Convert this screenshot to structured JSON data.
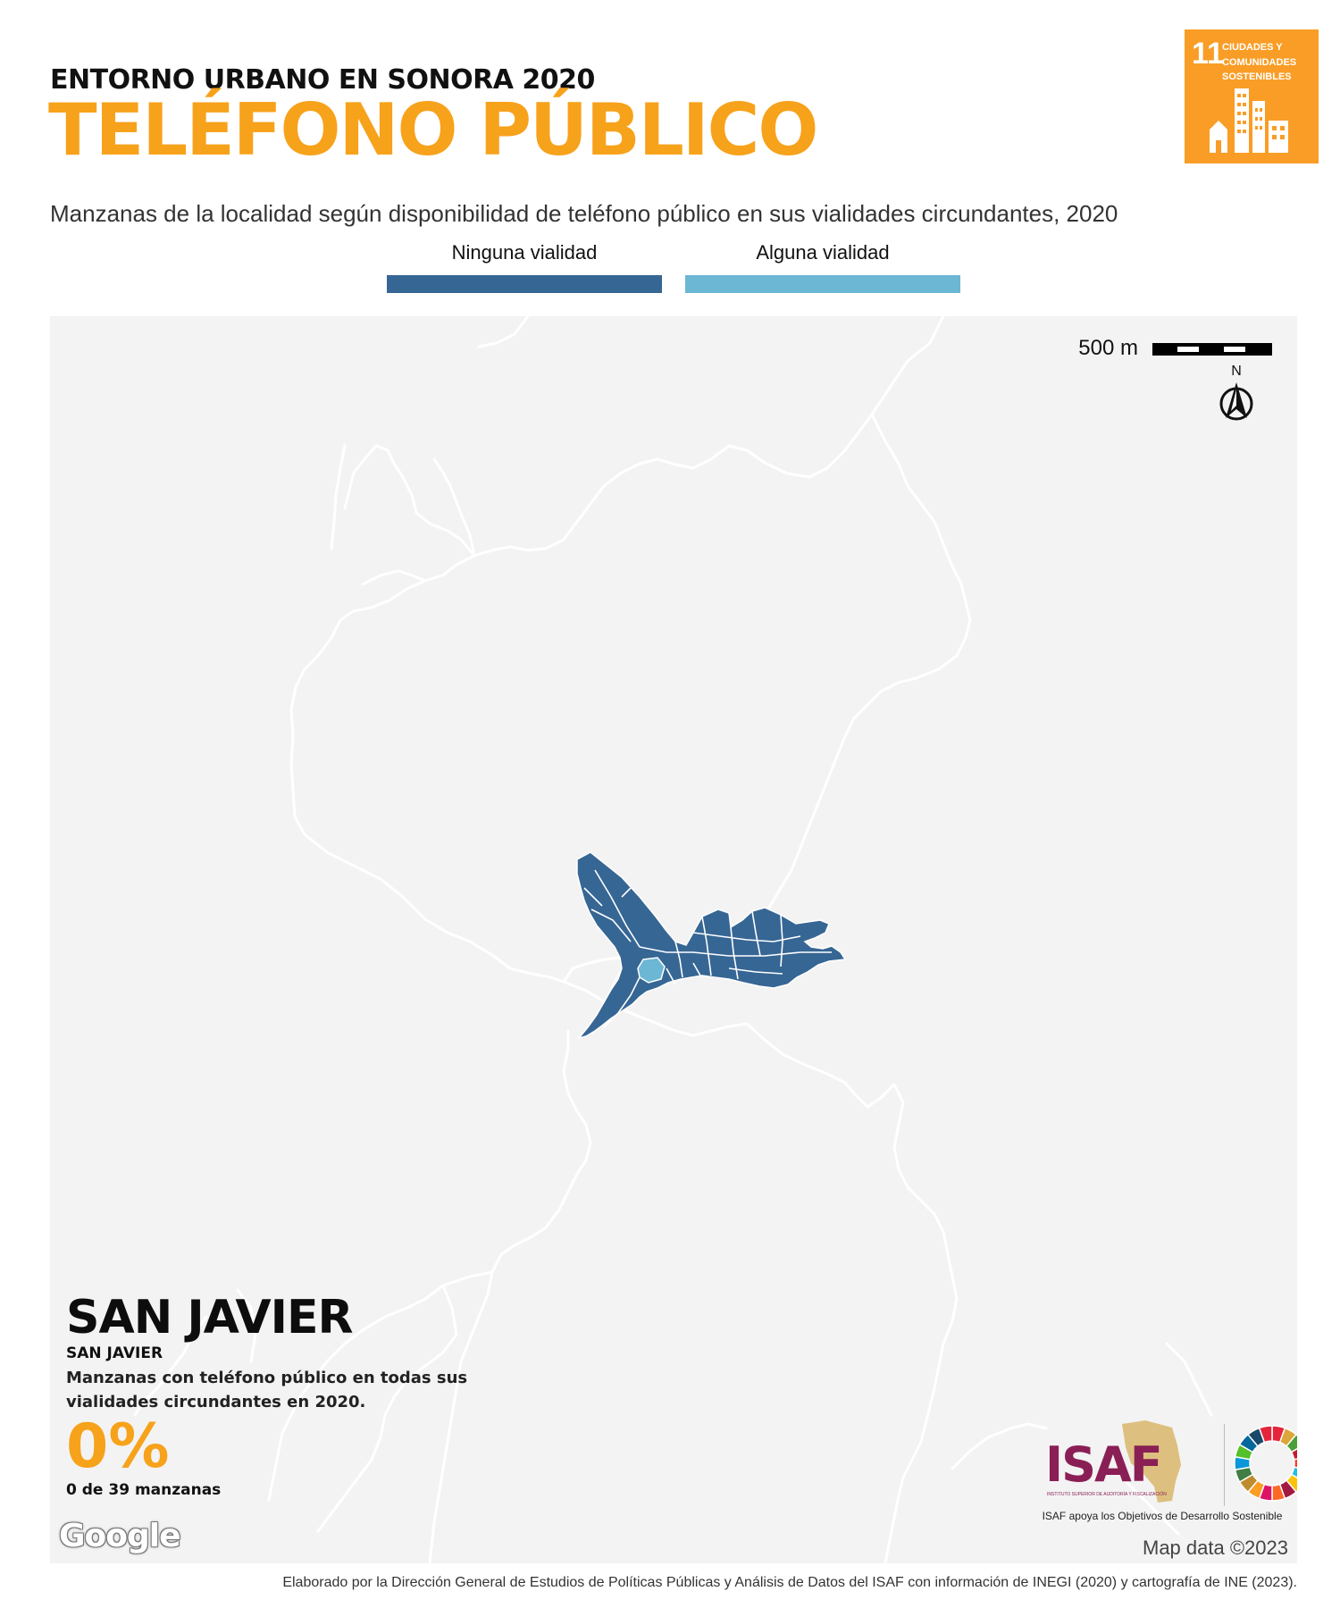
{
  "header": {
    "kicker": "ENTORNO URBANO EN SONORA 2020",
    "title": "TELÉFONO PÚBLICO",
    "subtitle": "Manzanas de la localidad según disponibilidad de teléfono público en sus vialidades circundantes, 2020"
  },
  "sdg_badge": {
    "number": "11",
    "text": "CIUDADES Y COMUNIDADES SOSTENIBLES",
    "color": "#f99d26"
  },
  "legend": {
    "items": [
      {
        "label": "Ninguna vialidad",
        "color": "#366694"
      },
      {
        "label": "Alguna vialidad",
        "color": "#6cb7d4"
      }
    ]
  },
  "map": {
    "scale_label": "500 m",
    "north_label": "N",
    "attribution_logo": "Google",
    "attribution": "Map data ©2023",
    "colors": {
      "background": "#f3f3f3",
      "roads": "#ffffff",
      "blocks_none": "#366694",
      "blocks_some": "#6cb7d4"
    }
  },
  "info": {
    "place": "SAN JAVIER",
    "municipality": "SAN JAVIER",
    "description": "Manzanas con teléfono público en todas sus vialidades circundantes en 2020.",
    "percentage": "0%",
    "count": "0 de 39 manzanas"
  },
  "logos": {
    "isaf": "ISAF",
    "isaf_sub": "INSTITUTO SUPERIOR DE AUDITORÍA Y FISCALIZACIÓN",
    "caption": "ISAF apoya los Objetivos de Desarrollo Sostenible"
  },
  "footer": {
    "text": "Elaborado por la Dirección General de Estudios de Políticas Públicas y Análisis de Datos del ISAF con información de INEGI (2020) y cartografía de INE (2023)."
  }
}
